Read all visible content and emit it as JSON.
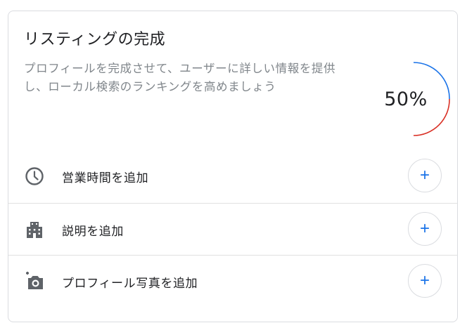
{
  "card": {
    "title": "リスティングの完成",
    "description": "プロフィールを完成させて、ユーザーに詳しい情報を提供し、ローカル検索のランキングを高めましょう",
    "progress": {
      "label": "50%",
      "value": 0.5,
      "colors": {
        "blue": "#1a73e8",
        "red": "#d93025"
      }
    }
  },
  "tasks": [
    {
      "icon": "clock-icon",
      "label": "営業時間を追加",
      "button": "+"
    },
    {
      "icon": "building-icon",
      "label": "説明を追加",
      "button": "+"
    },
    {
      "icon": "add-photo-icon",
      "label": "プロフィール写真を追加",
      "button": "+"
    }
  ],
  "accent_color": "#1a73e8"
}
